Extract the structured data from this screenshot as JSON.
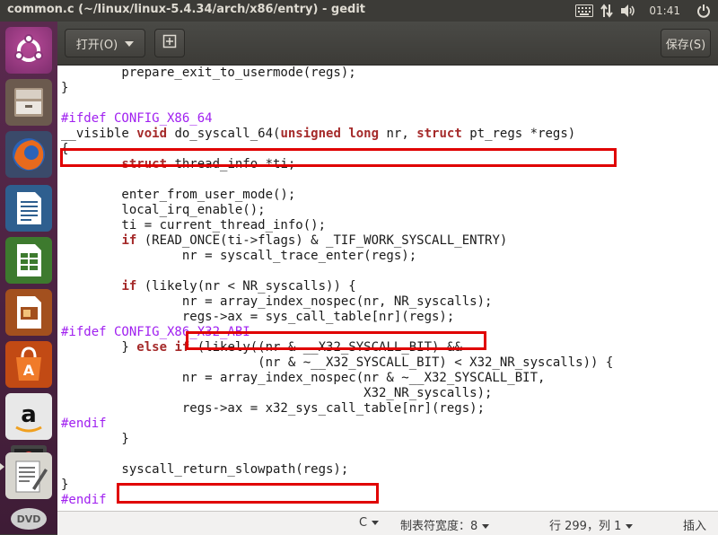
{
  "window": {
    "title": "common.c (~/linux/linux-5.4.34/arch/x86/entry) - gedit"
  },
  "top_panel": {
    "clock": "01:41",
    "indicators": [
      "keyboard-icon",
      "network-icon",
      "volume-icon",
      "power-icon"
    ]
  },
  "launcher": {
    "items": [
      "ubuntu-logo-icon",
      "files-icon",
      "firefox-icon",
      "writer-icon",
      "calc-icon",
      "impress-icon",
      "software-center-icon",
      "amazon-icon",
      "screenshot-icon",
      "text-editor-icon",
      "dvd-icon"
    ]
  },
  "toolbar": {
    "open_label": "打开(O)",
    "save_label": "保存(S)"
  },
  "code": {
    "lines": [
      "        prepare_exit_to_usermode(regs);",
      "}",
      "",
      "#ifdef CONFIG_X86_64",
      "__visible void do_syscall_64(unsigned long nr, struct pt_regs *regs)",
      "{",
      "        struct thread_info *ti;",
      "",
      "        enter_from_user_mode();",
      "        local_irq_enable();",
      "        ti = current_thread_info();",
      "        if (READ_ONCE(ti->flags) & _TIF_WORK_SYSCALL_ENTRY)",
      "                nr = syscall_trace_enter(regs);",
      "",
      "        if (likely(nr < NR_syscalls)) {",
      "                nr = array_index_nospec(nr, NR_syscalls);",
      "                regs->ax = sys_call_table[nr](regs);",
      "#ifdef CONFIG_X86_X32_ABI",
      "        } else if (likely((nr & __X32_SYSCALL_BIT) &&",
      "                          (nr & ~__X32_SYSCALL_BIT) < X32_NR_syscalls)) {",
      "                nr = array_index_nospec(nr & ~__X32_SYSCALL_BIT,",
      "                                        X32_NR_syscalls);",
      "                regs->ax = x32_sys_call_table[nr](regs);",
      "#endif",
      "        }",
      "",
      "        syscall_return_slowpath(regs);",
      "}",
      "#endif"
    ]
  },
  "status_bar": {
    "language": "C",
    "tab_width_label": "制表符宽度：",
    "tab_width_value": "8",
    "position": "行 299，列 1",
    "mode": "插入"
  },
  "colors": {
    "annotation_box": "#e00000",
    "keyword": "#a52a2a",
    "preprocessor": "#a020f0"
  }
}
